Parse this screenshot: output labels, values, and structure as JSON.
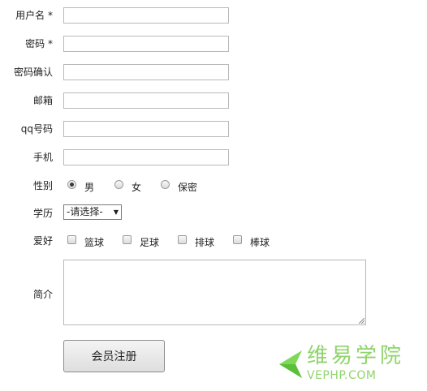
{
  "form": {
    "username": {
      "label": "用户名 *",
      "value": ""
    },
    "password": {
      "label": "密码 *",
      "value": ""
    },
    "password_confirm": {
      "label": "密码确认",
      "value": ""
    },
    "email": {
      "label": "邮箱",
      "value": ""
    },
    "qq": {
      "label": "qq号码",
      "value": ""
    },
    "phone": {
      "label": "手机",
      "value": ""
    },
    "gender": {
      "label": "性别",
      "options": [
        {
          "label": "男",
          "checked": true
        },
        {
          "label": "女",
          "checked": false
        },
        {
          "label": "保密",
          "checked": false
        }
      ]
    },
    "education": {
      "label": "学历",
      "selected": "-请选择-"
    },
    "hobbies": {
      "label": "爱好",
      "options": [
        {
          "label": "篮球",
          "checked": false
        },
        {
          "label": "足球",
          "checked": false
        },
        {
          "label": "排球",
          "checked": false
        },
        {
          "label": "棒球",
          "checked": false
        }
      ]
    },
    "intro": {
      "label": "简介",
      "value": ""
    },
    "submit_label": "会员注册"
  },
  "watermark": {
    "brand_cn": "维易学院",
    "brand_url": "VEPHP.COM",
    "color": "#8fd46a",
    "logo_icon": "green-arrow-logo-icon"
  }
}
